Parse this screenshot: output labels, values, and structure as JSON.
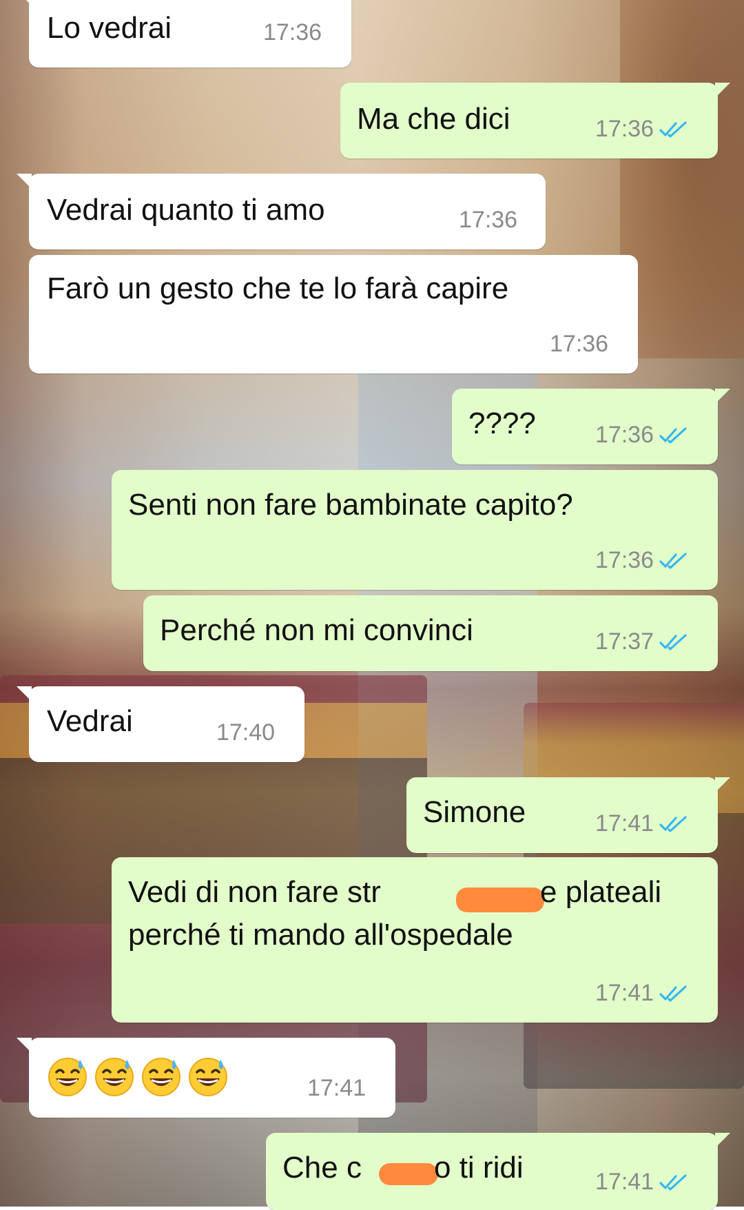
{
  "messages": [
    {
      "id": "m1",
      "direction": "incoming",
      "text": "Lo vedrai",
      "time": "17:36"
    },
    {
      "id": "m2",
      "direction": "outgoing",
      "text": "Ma che dici",
      "time": "17:36",
      "status": "read"
    },
    {
      "id": "m3",
      "direction": "incoming",
      "text": "Vedrai quanto ti amo",
      "time": "17:36"
    },
    {
      "id": "m4",
      "direction": "incoming",
      "text": "Farò un gesto che te lo farà capire",
      "time": "17:36"
    },
    {
      "id": "m5",
      "direction": "outgoing",
      "text": "????",
      "time": "17:36",
      "status": "read"
    },
    {
      "id": "m6",
      "direction": "outgoing",
      "text": "Senti non fare bambinate capito?",
      "time": "17:36",
      "status": "read"
    },
    {
      "id": "m7",
      "direction": "outgoing",
      "text": "Perché non mi convinci",
      "time": "17:37",
      "status": "read"
    },
    {
      "id": "m8",
      "direction": "incoming",
      "text": "Vedrai",
      "time": "17:40"
    },
    {
      "id": "m9",
      "direction": "outgoing",
      "text": "Simone",
      "time": "17:41",
      "status": "read"
    },
    {
      "id": "m10",
      "direction": "outgoing",
      "line1_start": "Vedi di non fare str",
      "line1_end": "e plateali",
      "line2": "perché ti mando all'ospedale",
      "time": "17:41",
      "status": "read",
      "redacted": true
    },
    {
      "id": "m11",
      "direction": "incoming",
      "emojis": [
        "😅",
        "😅",
        "😅",
        "😅"
      ],
      "emoji_name": "grinning-face-with-sweat",
      "time": "17:41"
    },
    {
      "id": "m12",
      "direction": "outgoing",
      "text_start": "Che c",
      "text_end": "o ti ridi",
      "time": "17:41",
      "status": "read",
      "redacted": true
    }
  ],
  "colors": {
    "incoming_bubble": "#ffffff",
    "outgoing_bubble": "#e2fdca",
    "read_ticks": "#34b7f1",
    "time_text": "#8a8a8a",
    "redaction": "#ff8a3d"
  },
  "icons": {
    "read_receipt": "double-check-icon"
  }
}
